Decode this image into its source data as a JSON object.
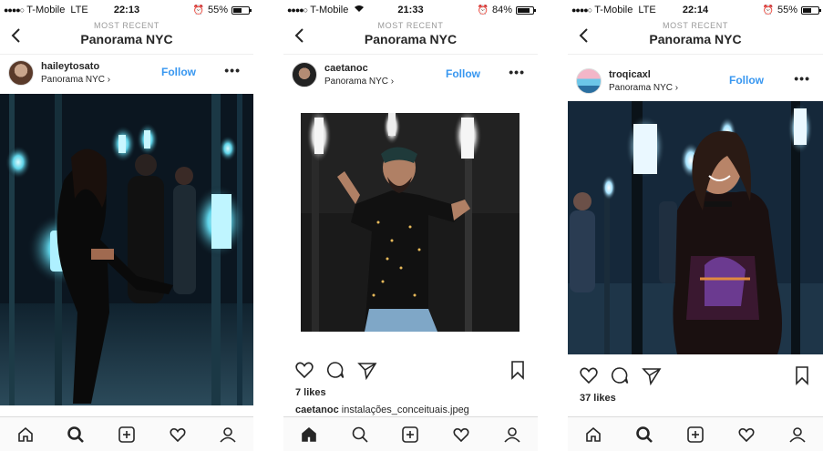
{
  "screens": [
    {
      "status": {
        "carrier": "T-Mobile",
        "network": "LTE",
        "time": "22:13",
        "battery": "55%",
        "battery_level": 0.55
      },
      "nav": {
        "subtitle": "MOST RECENT",
        "title": "Panorama NYC"
      },
      "post": {
        "username": "haileytosato",
        "location": "Panorama NYC",
        "follow": "Follow",
        "likes": "",
        "caption_user": "",
        "caption_text": ""
      },
      "active_tab": "search"
    },
    {
      "status": {
        "carrier": "T-Mobile",
        "network": "",
        "time": "21:33",
        "battery": "84%",
        "battery_level": 0.84
      },
      "nav": {
        "subtitle": "MOST RECENT",
        "title": "Panorama NYC"
      },
      "post": {
        "username": "caetanoc",
        "location": "Panorama NYC",
        "follow": "Follow",
        "likes": "7 likes",
        "caption_user": "caetanoc",
        "caption_text": "instalações_conceituais.jpeg"
      },
      "active_tab": "home"
    },
    {
      "status": {
        "carrier": "T-Mobile",
        "network": "LTE",
        "time": "22:14",
        "battery": "55%",
        "battery_level": 0.55
      },
      "nav": {
        "subtitle": "MOST RECENT",
        "title": "Panorama NYC"
      },
      "post": {
        "username": "troqicaxl",
        "location": "Panorama NYC",
        "follow": "Follow",
        "likes": "37 likes",
        "caption_user": "",
        "caption_text": ""
      },
      "active_tab": "search"
    }
  ],
  "colors": {
    "follow": "#3897f0",
    "text": "#262626",
    "muted": "#999999"
  },
  "icons": [
    "back-chevron-icon",
    "more-icon",
    "heart-icon",
    "comment-icon",
    "share-icon",
    "bookmark-icon",
    "home-icon",
    "search-icon",
    "add-icon",
    "activity-icon",
    "profile-icon"
  ]
}
